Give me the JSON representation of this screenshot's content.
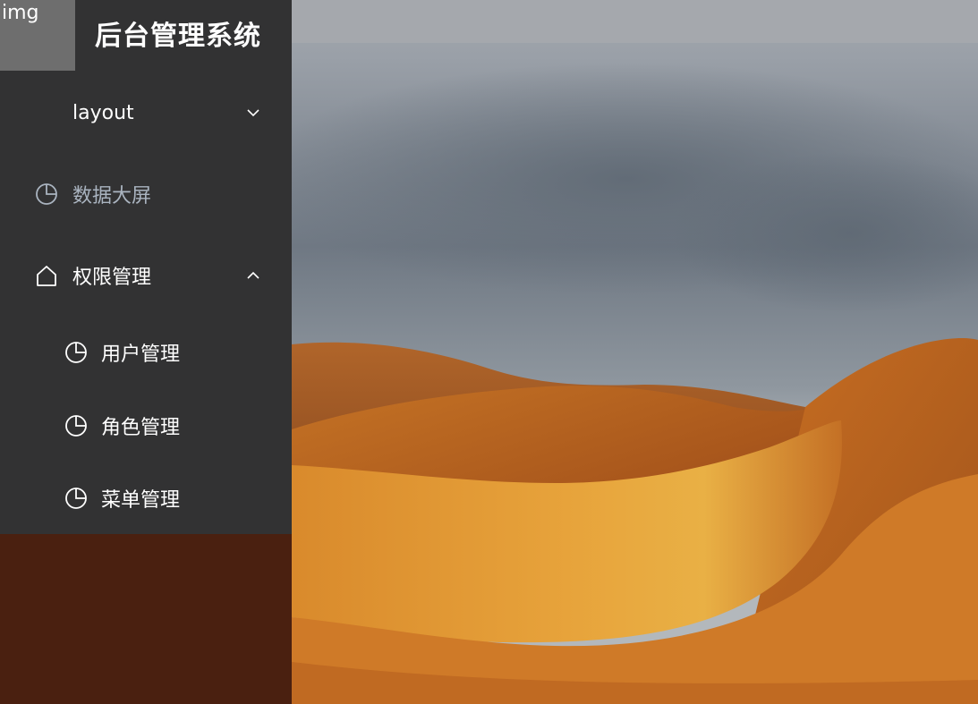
{
  "logo": {
    "placeholder_text": "img"
  },
  "app_title": "后台管理系统",
  "sidebar": {
    "items": [
      {
        "label": "layout",
        "expanded": false,
        "icon": "chevron-down-icon"
      },
      {
        "label": "数据大屏",
        "icon": "pie-chart-icon"
      },
      {
        "label": "权限管理",
        "expanded": true,
        "icon": "home-icon"
      }
    ],
    "sub_items": [
      {
        "label": "用户管理",
        "icon": "pie-chart-icon"
      },
      {
        "label": "角色管理",
        "icon": "pie-chart-icon"
      },
      {
        "label": "菜单管理",
        "icon": "pie-chart-icon"
      }
    ]
  },
  "colors": {
    "sidebar_bg": "#323233",
    "active_item_text": "#aab4c0",
    "sidebar_text": "#ffffff"
  }
}
